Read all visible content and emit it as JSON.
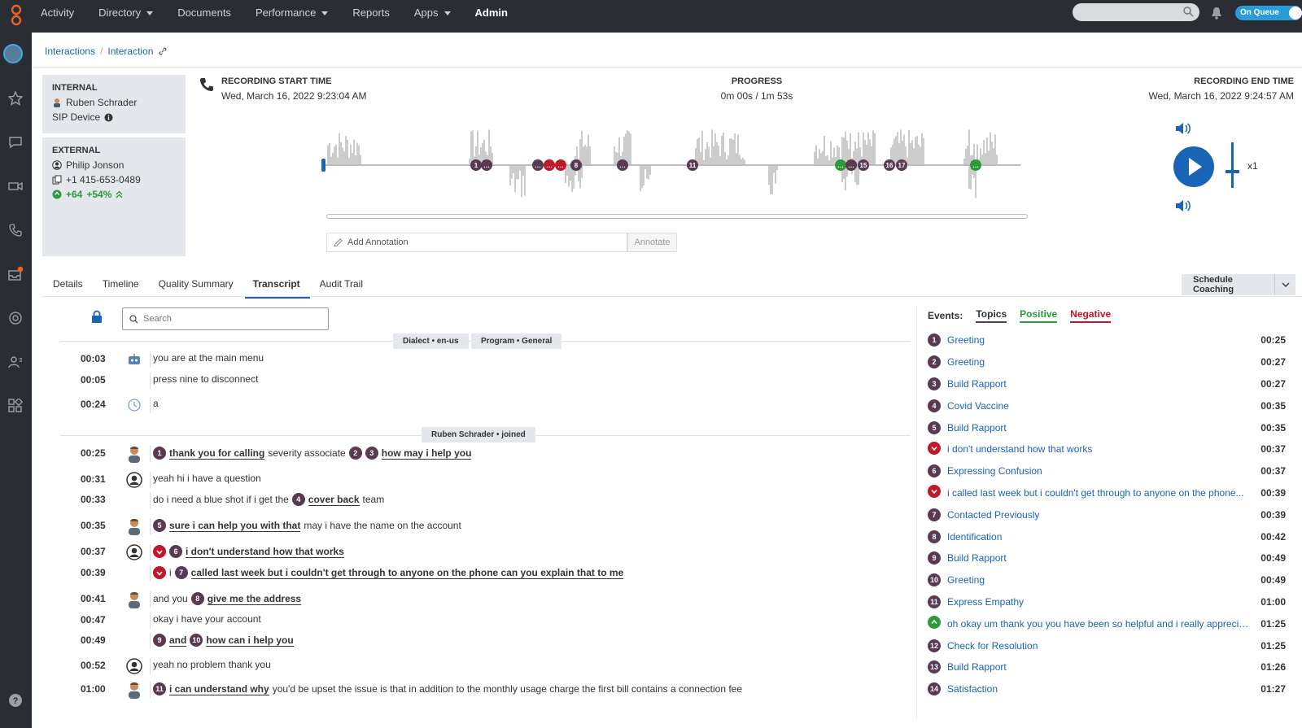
{
  "nav": {
    "items": [
      {
        "label": "Activity",
        "dropdown": false,
        "active": false
      },
      {
        "label": "Directory",
        "dropdown": true,
        "active": false
      },
      {
        "label": "Documents",
        "dropdown": false,
        "active": false
      },
      {
        "label": "Performance",
        "dropdown": true,
        "active": false
      },
      {
        "label": "Reports",
        "dropdown": false,
        "active": false
      },
      {
        "label": "Apps",
        "dropdown": true,
        "active": false
      },
      {
        "label": "Admin",
        "dropdown": false,
        "active": true
      }
    ],
    "status": "On Queue"
  },
  "sidebar_icons": [
    "avatar",
    "star-icon",
    "chat-icon",
    "video-icon",
    "phone-icon",
    "inbox-icon",
    "help-ring-icon",
    "people-icon",
    "apps-icon",
    "help-icon"
  ],
  "breadcrumb": {
    "root": "Interactions",
    "current": "Interaction"
  },
  "internal": {
    "label": "INTERNAL",
    "name": "Ruben Schrader",
    "device": "SIP Device"
  },
  "external": {
    "label": "EXTERNAL",
    "name": "Philip Jonson",
    "phone": "+1 415-653-0489",
    "score": "+64",
    "percent": "+54%"
  },
  "recording": {
    "start_label": "RECORDING START TIME",
    "start_value": "Wed, March 16, 2022 9:23:04 AM",
    "progress_label": "PROGRESS",
    "progress_value": "0m 00s / 1m 53s",
    "end_label": "RECORDING END TIME",
    "end_value": "Wed, March 16, 2022 9:24:57 AM",
    "speed": "x1"
  },
  "annotation": {
    "placeholder": "Add Annotation",
    "button": "Annotate"
  },
  "tabs": [
    "Details",
    "Timeline",
    "Quality Summary",
    "Transcript",
    "Audit Trail"
  ],
  "active_tab": "Transcript",
  "coaching_button": "Schedule Coaching",
  "transcript": {
    "search_placeholder": "Search",
    "pills": {
      "dialect": "Dialect • en-us",
      "program": "Program • General",
      "joined": "Ruben Schrader • joined"
    },
    "lines": [
      {
        "time": "00:03",
        "who": "bot",
        "parts": [
          {
            "t": "you are at the main menu"
          }
        ]
      },
      {
        "time": "00:05",
        "who": "",
        "parts": [
          {
            "t": "press nine to disconnect"
          }
        ]
      },
      {
        "time": "00:24",
        "who": "clock",
        "parts": [
          {
            "t": "a"
          }
        ]
      },
      {
        "time": "00:25",
        "who": "agent",
        "parts": [
          {
            "n": "1"
          },
          {
            "t": "thank you for calling",
            "u": true
          },
          {
            "t": "severity associate"
          },
          {
            "n": "2"
          },
          {
            "n": "3"
          },
          {
            "t": "how may i help you",
            "u": true
          }
        ]
      },
      {
        "time": "00:31",
        "who": "customer",
        "parts": [
          {
            "t": "yeah hi i have a question"
          }
        ]
      },
      {
        "time": "00:33",
        "who": "",
        "parts": [
          {
            "t": "do i need a blue shot if i get the"
          },
          {
            "n": "4"
          },
          {
            "t": "cover back",
            "u": true
          },
          {
            "t": "team"
          }
        ]
      },
      {
        "time": "00:35",
        "who": "agent",
        "parts": [
          {
            "n": "5"
          },
          {
            "t": "sure i can help you with that",
            "u": true
          },
          {
            "t": "may i have the name on the account"
          }
        ]
      },
      {
        "time": "00:37",
        "who": "customer",
        "parts": [
          {
            "neg": true
          },
          {
            "n": "6"
          },
          {
            "t": "i don't understand how that works",
            "u": true
          }
        ]
      },
      {
        "time": "00:39",
        "who": "",
        "parts": [
          {
            "neg": true
          },
          {
            "t": "i"
          },
          {
            "n": "7"
          },
          {
            "t": "called last week but i couldn't get through to anyone on the phone can you explain that to me",
            "u": true
          }
        ]
      },
      {
        "time": "00:41",
        "who": "agent",
        "parts": [
          {
            "t": "and you"
          },
          {
            "n": "8"
          },
          {
            "t": "give me the address",
            "u": true
          }
        ]
      },
      {
        "time": "00:47",
        "who": "",
        "parts": [
          {
            "t": "okay i have your account"
          }
        ]
      },
      {
        "time": "00:49",
        "who": "",
        "parts": [
          {
            "n": "9"
          },
          {
            "t": "and",
            "u": true
          },
          {
            "n": "10"
          },
          {
            "t": "how can i help you",
            "u": true
          }
        ]
      },
      {
        "time": "00:52",
        "who": "customer",
        "parts": [
          {
            "t": "yeah no problem thank you"
          }
        ]
      },
      {
        "time": "01:00",
        "who": "agent",
        "parts": [
          {
            "n": "11"
          },
          {
            "t": "i can understand why",
            "u": true
          },
          {
            "t": "you'd be upset the issue is that in addition to the monthly usage charge the first bill contains a connection fee"
          }
        ]
      }
    ]
  },
  "events": {
    "label": "Events:",
    "filters": [
      {
        "label": "Topics",
        "color": "#5a3a52"
      },
      {
        "label": "Positive",
        "color": "#2c9a3b"
      },
      {
        "label": "Negative",
        "color": "#c0182a"
      }
    ],
    "items": [
      {
        "kind": "num",
        "n": "1",
        "label": "Greeting",
        "time": "00:25"
      },
      {
        "kind": "num",
        "n": "2",
        "label": "Greeting",
        "time": "00:27"
      },
      {
        "kind": "num",
        "n": "3",
        "label": "Build Rapport",
        "time": "00:27"
      },
      {
        "kind": "num",
        "n": "4",
        "label": "Covid Vaccine",
        "time": "00:35"
      },
      {
        "kind": "num",
        "n": "5",
        "label": "Build Rapport",
        "time": "00:35"
      },
      {
        "kind": "neg",
        "n": "",
        "label": "i don't understand how that works",
        "time": "00:37"
      },
      {
        "kind": "num",
        "n": "6",
        "label": "Expressing Confusion",
        "time": "00:37"
      },
      {
        "kind": "neg",
        "n": "",
        "label": "i called last week but i couldn't get through to anyone on the phone...",
        "time": "00:39"
      },
      {
        "kind": "num",
        "n": "7",
        "label": "Contacted Previously",
        "time": "00:39"
      },
      {
        "kind": "num",
        "n": "8",
        "label": "Identification",
        "time": "00:42"
      },
      {
        "kind": "num",
        "n": "9",
        "label": "Build Rapport",
        "time": "00:49"
      },
      {
        "kind": "num",
        "n": "10",
        "label": "Greeting",
        "time": "00:49"
      },
      {
        "kind": "num",
        "n": "11",
        "label": "Express Empathy",
        "time": "01:00"
      },
      {
        "kind": "pos",
        "n": "",
        "label": "oh okay um thank you you have been so helpful and i really apprecia...",
        "time": "01:25"
      },
      {
        "kind": "num",
        "n": "12",
        "label": "Check for Resolution",
        "time": "01:25"
      },
      {
        "kind": "num",
        "n": "13",
        "label": "Build Rapport",
        "time": "01:26"
      },
      {
        "kind": "num",
        "n": "14",
        "label": "Satisfaction",
        "time": "01:27"
      }
    ]
  },
  "colors": {
    "accent": "#1a64b5",
    "topic": "#5a3a52",
    "positive": "#2c9a3b",
    "negative": "#c0182a",
    "chrome": "#2a2e33"
  }
}
